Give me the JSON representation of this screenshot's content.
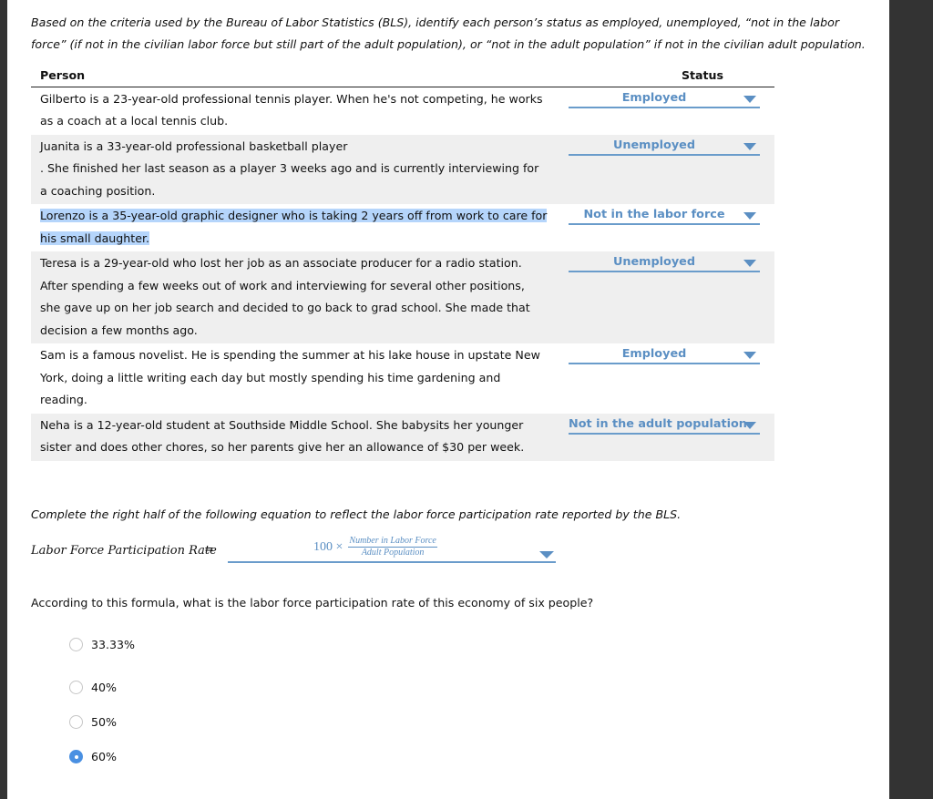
{
  "instructions": "Based on the criteria used by the Bureau of Labor Statistics (BLS), identify each person’s status as employed, unemployed, “not in the labor force” (if not in the civilian labor force but still part of the adult population), or “not in the adult population” if not in the civilian adult population.",
  "table": {
    "headers": {
      "person": "Person",
      "status": "Status"
    },
    "rows": [
      {
        "person": "Gilberto is a 23-year-old professional tennis player. When he's not competing, he works as a coach at a local tennis club.",
        "status": "Employed"
      },
      {
        "person_line1": "Juanita is a 33-year-old professional basketball player",
        "person": ". She finished her last season as a player 3 weeks ago and is currently interviewing for a coaching position.",
        "status": "Unemployed"
      },
      {
        "person": "Lorenzo is a 35-year-old graphic designer who is taking 2 years off from work to care for his small daughter.",
        "status": "Not in the labor force"
      },
      {
        "person": "Teresa is a 29-year-old who lost her job as an associate producer for a radio station. After spending a few weeks out of work and interviewing for several other positions, she gave up on her job search and decided to go back to grad school. She made that decision a few months ago.",
        "status": "Unemployed"
      },
      {
        "person": "Sam is a famous novelist. He is spending the summer at his lake house in upstate New York, doing a little writing each day but mostly spending his time gardening and reading.",
        "status": "Employed"
      },
      {
        "person": "Neha is a 12-year-old student at Southside Middle School. She babysits her younger sister and does other chores, so her parents give her an allowance of $30 per week.",
        "status": "Not in the adult population"
      }
    ]
  },
  "equation": {
    "prompt": "Complete the right half of the following equation to reflect the labor force participation rate reported by the BLS.",
    "label": "Labor Force Participation Rate",
    "equals": "=",
    "selected": {
      "multiplier": "100 ×",
      "numerator": "Number in Labor Force",
      "denominator": "Adult Population"
    }
  },
  "question": {
    "text": "According to this formula, what is the labor force participation rate of this economy of six people?",
    "options": [
      {
        "label": "33.33%",
        "selected": false
      },
      {
        "label": "40%",
        "selected": false
      },
      {
        "label": "50%",
        "selected": false
      },
      {
        "label": "60%",
        "selected": true
      }
    ]
  },
  "colors": {
    "accent": "#5b8fc3",
    "underline": "#6a9ccb",
    "row_shade": "#efefef",
    "selection_highlight": "#b5d5fb",
    "radio_selected": "#4a90e2",
    "frame": "#333333"
  }
}
